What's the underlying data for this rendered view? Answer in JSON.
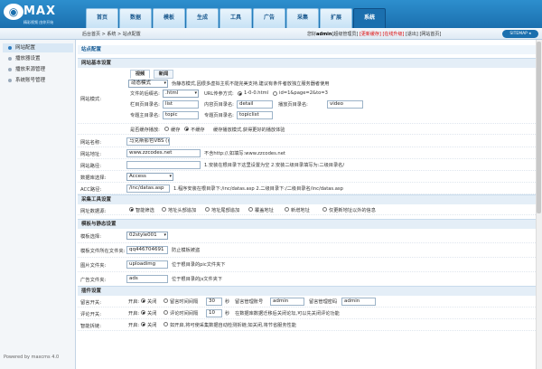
{
  "logo": {
    "brand": "MAX",
    "slogan": "精彩视频 由你开始"
  },
  "nav": {
    "tabs": [
      "首页",
      "数据",
      "模板",
      "生成",
      "工具",
      "广告",
      "采集",
      "扩展",
      "系统"
    ],
    "active_index": 8
  },
  "breadcrumb": "后台首页 > 系统 > 站点配置",
  "userbar": {
    "greeting": "您好",
    "user": "admin",
    "role": "[超级管理员]",
    "clear_cache": "[更新缓存]",
    "online_upgrade": "[在线升级]",
    "logout": "[退出]",
    "site_home": "[网站首页]"
  },
  "sitemap_label": "SITEMAP",
  "sidebar": {
    "items": [
      "网站配置",
      "播放器设置",
      "播放来源管理",
      "系统账号管理"
    ],
    "active_index": 0
  },
  "powered": "Powered by maxcms 4.0",
  "page_title": "站点配置",
  "basic": {
    "section": "网站基本设置",
    "subtabs": [
      "视频",
      "新闻"
    ],
    "run_mode_label": "网站模式:",
    "mode_select": "动态模式",
    "mode_hint": "伪静态模式,因很多虚拟主机不能完美支持,建议有条件者放独立服务器者使用",
    "ext_label": "文件的后缀名:",
    "ext_value": ".html",
    "url_style_label": "URL传参方式:",
    "url_style_opt1": "1-0-0.html",
    "url_style_opt2": "id=1&page=2&to=3",
    "col_dir_label": "栏目页目录名:",
    "col_dir": "list",
    "content_dir_label": "内容页目录名:",
    "content_dir": "detail",
    "play_dir_label": "播放页目录名:",
    "play_dir": "video",
    "topic_dir_label": "专题主目录名:",
    "topic_dir": "topic",
    "topiclist_dir_label": "专题页目录名:",
    "topiclist_dir": "topiclist",
    "cache_label": "是否缓存播放:",
    "cache_opt1": "缓存",
    "cache_opt2": "不缓存",
    "cache_hint": "缓存播放模式,获得更好的播放体验"
  },
  "site_rows": [
    {
      "label": "网站名称:",
      "value": "马克斯影色VBS (商业源码网)",
      "hint": ""
    },
    {
      "label": "网站地址:",
      "value": "www.zzcodes.net",
      "hint": "不含http://,如填写:www.zzcodes.net"
    },
    {
      "label": "网站路径:",
      "value": "",
      "hint": "1.安装在根目录下这里设置为空 2.安装二级目录填写为:二级目录名/"
    },
    {
      "label": "数据库选择:",
      "value": "Access",
      "hint": ""
    },
    {
      "label": "ACC路径:",
      "value": "/inc/datas.asp",
      "hint": "1.程序安装在根目录下:/inc/datas.asp   2.二级目录下:/二级目录名/inc/datas.asp"
    }
  ],
  "collect": {
    "section": "采集工具设置",
    "label": "网址数据源:",
    "options": [
      "智能筛选",
      "地址头部追加",
      "地址尾部追加",
      "覆盖地址",
      "新增地址",
      "仅更新地址以外的信息"
    ]
  },
  "template": {
    "section": "模板与静态设置",
    "rows": [
      {
        "label": "模板选择:",
        "value": "02style001",
        "hint": ""
      },
      {
        "label": "模板文件所在文件夹:",
        "value": "qq446704691",
        "hint": "防止模板被盗"
      },
      {
        "label": "图片文件夹:",
        "value": "uploadimg",
        "hint": "位于根目录的pic文件夹下"
      },
      {
        "label": "广告文件夹:",
        "value": "ads",
        "hint": "位于根目录的js文件夹下"
      }
    ]
  },
  "plugin": {
    "section": "插件设置",
    "rows": [
      {
        "label": "留言开关:",
        "open": "开启:",
        "on": "关闭",
        "interval_label": "留言时间间隔",
        "interval": "30",
        "unit": "秒",
        "admin_label": "留言管理账号",
        "admin": "admin",
        "pw_label": "留言管理密码",
        "pw": "admin"
      },
      {
        "label": "评论开关:",
        "open": "开启:",
        "on": "关闭",
        "interval_label": "评论时间间隔",
        "interval": "10",
        "unit": "秒",
        "hint": "在数据库数据迁移后关闭论坛,可以先关闭评论功能"
      },
      {
        "label": "智能拆链:",
        "open": "开启:",
        "on": "关闭",
        "hint": "如开启,将可使采集数据自动检测拆链;如关闭,将节省服务性能"
      }
    ]
  }
}
